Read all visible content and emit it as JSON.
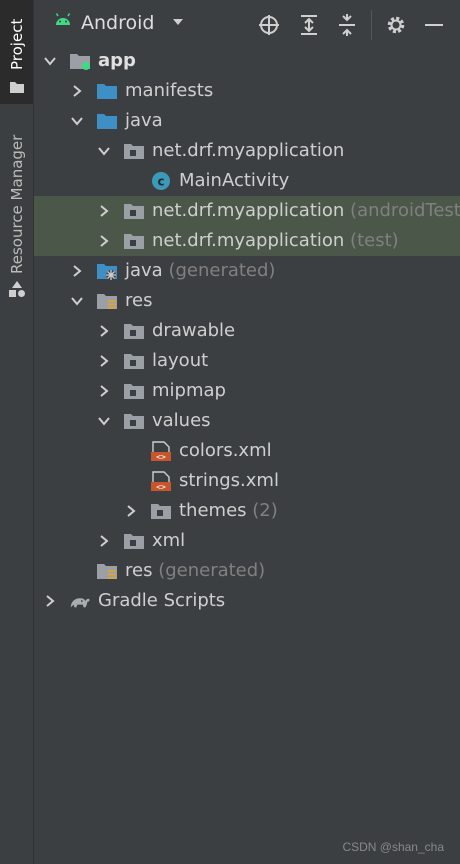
{
  "side_tabs": {
    "project": "Project",
    "resource_manager": "Resource Manager"
  },
  "toolbar": {
    "view_mode": "Android",
    "icons": [
      "android-icon",
      "dropdown-icon",
      "locate-icon",
      "expand-all-icon",
      "collapse-all-icon",
      "gear-icon",
      "minimize-icon"
    ]
  },
  "tree": [
    {
      "label": "app",
      "suffix": "",
      "icon": "module-icon",
      "expanded": true
    },
    {
      "label": "manifests",
      "suffix": "",
      "icon": "folder-icon",
      "expanded": false
    },
    {
      "label": "java",
      "suffix": "",
      "icon": "folder-icon",
      "expanded": true
    },
    {
      "label": "net.drf.myapplication",
      "suffix": "",
      "icon": "package-icon",
      "expanded": true
    },
    {
      "label": "MainActivity",
      "suffix": "",
      "icon": "class-icon"
    },
    {
      "label": "net.drf.myapplication",
      "suffix": " (androidTest)",
      "icon": "package-icon",
      "expanded": false
    },
    {
      "label": "net.drf.myapplication",
      "suffix": " (test)",
      "icon": "package-icon",
      "expanded": false
    },
    {
      "label": "java",
      "suffix": " (generated)",
      "icon": "generated-folder-icon",
      "expanded": false
    },
    {
      "label": "res",
      "suffix": "",
      "icon": "res-folder-icon",
      "expanded": true
    },
    {
      "label": "drawable",
      "suffix": "",
      "icon": "package-icon",
      "expanded": false
    },
    {
      "label": "layout",
      "suffix": "",
      "icon": "package-icon",
      "expanded": false
    },
    {
      "label": "mipmap",
      "suffix": "",
      "icon": "package-icon",
      "expanded": false
    },
    {
      "label": "values",
      "suffix": "",
      "icon": "package-icon",
      "expanded": true
    },
    {
      "label": "colors.xml",
      "suffix": "",
      "icon": "xml-file-icon"
    },
    {
      "label": "strings.xml",
      "suffix": "",
      "icon": "xml-file-icon"
    },
    {
      "label": "themes",
      "suffix": " (2)",
      "icon": "package-icon",
      "expanded": false
    },
    {
      "label": "xml",
      "suffix": "",
      "icon": "package-icon",
      "expanded": false
    },
    {
      "label": "res",
      "suffix": " (generated)",
      "icon": "res-folder-icon"
    },
    {
      "label": "Gradle Scripts",
      "suffix": "",
      "icon": "gradle-icon",
      "expanded": false
    }
  ],
  "watermark": "CSDN @shan_cha",
  "colors": {
    "background": "#3c3f41",
    "highlight": "#4b5748",
    "folder_blue": "#3d8fc6",
    "android_green": "#3ddc84",
    "class_teal": "#3c9ab8",
    "xml_orange": "#c8562c"
  }
}
